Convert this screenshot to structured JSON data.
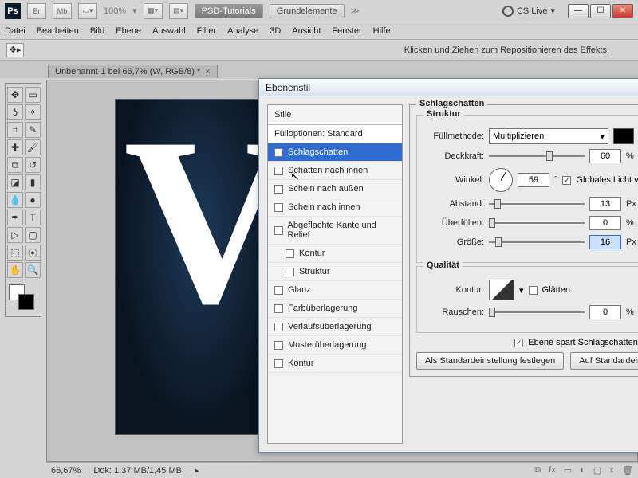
{
  "top": {
    "zoom": "100%",
    "btn1": "PSD-Tutorials",
    "btn2": "Grundelemente",
    "cslive": "CS Live"
  },
  "menu": [
    "Datei",
    "Bearbeiten",
    "Bild",
    "Ebene",
    "Auswahl",
    "Filter",
    "Analyse",
    "3D",
    "Ansicht",
    "Fenster",
    "Hilfe"
  ],
  "options_hint": "Klicken und Ziehen zum Repositionieren des Effekts.",
  "doc_tab": "Unbenannt-1 bei 66,7% (W, RGB/8) *",
  "status": {
    "zoom": "66,67%",
    "doc": "Dok: 1,37 MB/1,45 MB"
  },
  "canvas_letter": "V",
  "dialog": {
    "title": "Ebenenstil",
    "styles_header": "Stile",
    "styles": [
      {
        "label": "Fülloptionen: Standard",
        "checked": null,
        "indent": false
      },
      {
        "label": "Schlagschatten",
        "checked": true,
        "indent": false,
        "selected": true
      },
      {
        "label": "Schatten nach innen",
        "checked": false,
        "indent": false
      },
      {
        "label": "Schein nach außen",
        "checked": false,
        "indent": false
      },
      {
        "label": "Schein nach innen",
        "checked": false,
        "indent": false
      },
      {
        "label": "Abgeflachte Kante und Relief",
        "checked": false,
        "indent": false
      },
      {
        "label": "Kontur",
        "checked": false,
        "indent": true
      },
      {
        "label": "Struktur",
        "checked": false,
        "indent": true
      },
      {
        "label": "Glanz",
        "checked": false,
        "indent": false
      },
      {
        "label": "Farbüberlagerung",
        "checked": false,
        "indent": false
      },
      {
        "label": "Verlaufsüberlagerung",
        "checked": false,
        "indent": false
      },
      {
        "label": "Musterüberlagerung",
        "checked": false,
        "indent": false
      },
      {
        "label": "Kontur",
        "checked": false,
        "indent": false
      }
    ],
    "section_title": "Schlagschatten",
    "struktur": {
      "legend": "Struktur",
      "fill_label": "Füllmethode:",
      "fill_value": "Multiplizieren",
      "opacity_label": "Deckkraft:",
      "opacity_value": "60",
      "opacity_unit": "%",
      "angle_label": "Winkel:",
      "angle_value": "59",
      "angle_unit": "°",
      "global_label": "Globales Licht ver",
      "global_checked": true,
      "distance_label": "Abstand:",
      "distance_value": "13",
      "distance_unit": "Px",
      "spread_label": "Überfüllen:",
      "spread_value": "0",
      "spread_unit": "%",
      "size_label": "Größe:",
      "size_value": "16",
      "size_unit": "Px"
    },
    "qualitaet": {
      "legend": "Qualität",
      "contour_label": "Kontur:",
      "antialias_label": "Glätten",
      "noise_label": "Rauschen:",
      "noise_value": "0",
      "noise_unit": "%"
    },
    "spare_label": "Ebene spart Schlagschatten aus",
    "spare_checked": true,
    "btn_default": "Als Standardeinstellung festlegen",
    "btn_reset": "Auf Standardeinstell"
  }
}
